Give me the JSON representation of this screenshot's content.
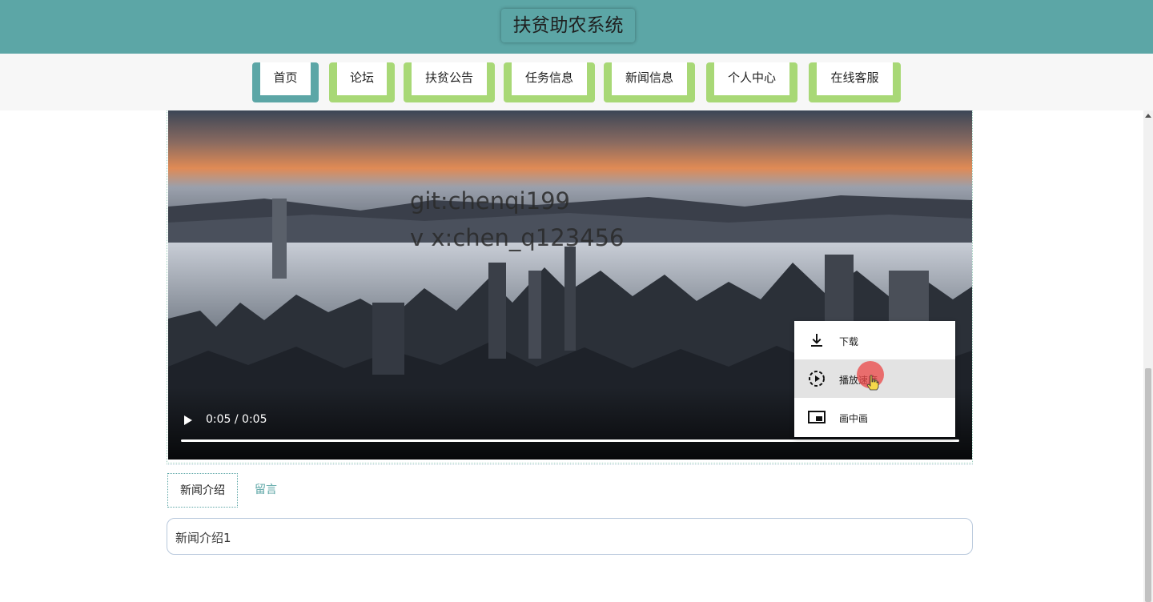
{
  "site": {
    "title": "扶贫助农系统"
  },
  "nav": {
    "items": [
      {
        "label": "首页",
        "active": true
      },
      {
        "label": "论坛",
        "active": false
      },
      {
        "label": "扶贫公告",
        "active": false
      },
      {
        "label": "任务信息",
        "active": false
      },
      {
        "label": "新闻信息",
        "active": false
      },
      {
        "label": "个人中心",
        "active": false
      },
      {
        "label": "在线客服",
        "active": false
      }
    ]
  },
  "video": {
    "watermark_line1": "git:chenqi199",
    "watermark_line2": "v x:chen_q123456",
    "time_display": "0:05 / 0:05",
    "progress": 1.0
  },
  "context_menu": {
    "items": [
      {
        "label": "下载",
        "icon": "download-icon"
      },
      {
        "label": "播放速度",
        "icon": "playback-speed-icon"
      },
      {
        "label": "画中画",
        "icon": "picture-in-picture-icon"
      }
    ]
  },
  "tabs": [
    {
      "label": "新闻介绍",
      "active": true
    },
    {
      "label": "留言",
      "active": false
    }
  ],
  "intro": {
    "text": "新闻介绍1"
  },
  "colors": {
    "header": "#5ca6a6",
    "nav_inactive": "#a8d876",
    "nav_active": "#5ca6a6"
  }
}
